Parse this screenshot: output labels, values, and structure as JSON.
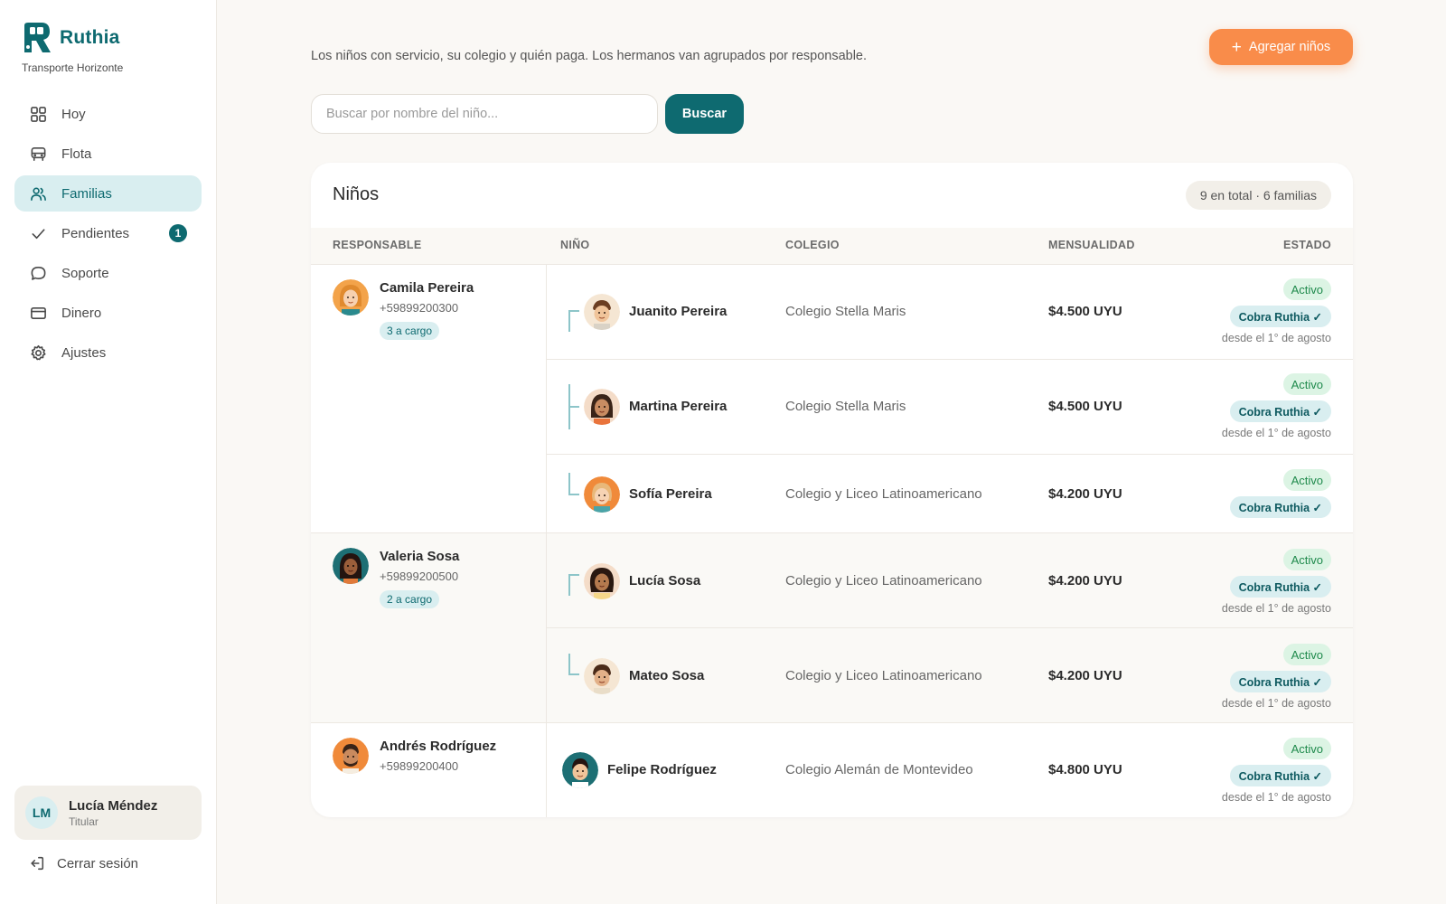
{
  "brand": {
    "name": "Ruthia",
    "subtitle": "Transporte Horizonte",
    "color": "#0e6a70"
  },
  "nav": [
    {
      "label": "Hoy",
      "icon": "grid-icon"
    },
    {
      "label": "Flota",
      "icon": "bus-icon"
    },
    {
      "label": "Familias",
      "icon": "users-icon",
      "active": true
    },
    {
      "label": "Pendientes",
      "icon": "check-icon",
      "badge": "1"
    },
    {
      "label": "Soporte",
      "icon": "chat-bubble-icon"
    },
    {
      "label": "Dinero",
      "icon": "credit-card-icon"
    },
    {
      "label": "Ajustes",
      "icon": "gear-icon"
    }
  ],
  "user": {
    "initials": "LM",
    "name": "Lucía Méndez",
    "role": "Titular"
  },
  "logout_label": "Cerrar sesión",
  "intro": "Los niños con servicio, su colegio y quién paga. Los hermanos van agrupados por responsable.",
  "add_button": "Agregar niños",
  "search": {
    "placeholder": "Buscar por nombre del niño...",
    "value": "",
    "button": "Buscar"
  },
  "table": {
    "title": "Niños",
    "summary": "9 en total · 6 familias",
    "columns": [
      "RESPONSABLE",
      "NIÑO",
      "COLEGIO",
      "MENSUALIDAD",
      "ESTADO"
    ],
    "groups": [
      {
        "name": "Camila Pereira",
        "phone": "+59899200300",
        "load": "3 a cargo",
        "kids": [
          {
            "name": "Juanito Pereira",
            "school": "Colegio Stella Maris",
            "fee": "$4.500 UYU",
            "status": "Activo",
            "billing": "Cobra Ruthia ✓",
            "since": "desde el 1° de agosto"
          },
          {
            "name": "Martina Pereira",
            "school": "Colegio Stella Maris",
            "fee": "$4.500 UYU",
            "status": "Activo",
            "billing": "Cobra Ruthia ✓",
            "since": "desde el 1° de agosto"
          },
          {
            "name": "Sofía Pereira",
            "school": "Colegio y Liceo Latinoamericano",
            "fee": "$4.200 UYU",
            "status": "Activo",
            "billing": "Cobra Ruthia ✓",
            "since": ""
          }
        ]
      },
      {
        "name": "Valeria Sosa",
        "phone": "+59899200500",
        "load": "2 a cargo",
        "kids": [
          {
            "name": "Lucía Sosa",
            "school": "Colegio y Liceo Latinoamericano",
            "fee": "$4.200 UYU",
            "status": "Activo",
            "billing": "Cobra Ruthia ✓",
            "since": "desde el 1° de agosto"
          },
          {
            "name": "Mateo Sosa",
            "school": "Colegio y Liceo Latinoamericano",
            "fee": "$4.200 UYU",
            "status": "Activo",
            "billing": "Cobra Ruthia ✓",
            "since": "desde el 1° de agosto"
          }
        ]
      },
      {
        "name": "Andrés Rodríguez",
        "phone": "+59899200400",
        "load": "",
        "kids": [
          {
            "name": "Felipe Rodríguez",
            "school": "Colegio Alemán de Montevideo",
            "fee": "$4.800 UYU",
            "status": "Activo",
            "billing": "Cobra Ruthia ✓",
            "since": "desde el 1° de agosto"
          }
        ]
      }
    ]
  },
  "colors": {
    "accent": "#0e6a70",
    "orange": "#f98c4a",
    "active_green": "#1f8a4c",
    "background": "#faf8f5"
  }
}
